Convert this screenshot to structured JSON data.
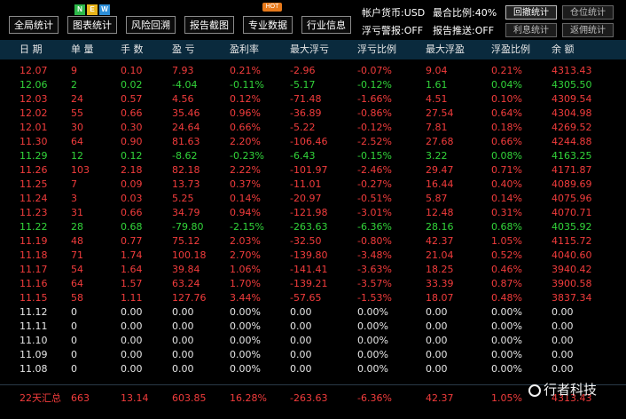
{
  "toolbar": {
    "buttons": [
      "全局统计",
      "图表统计",
      "风险回溯",
      "报告截图",
      "专业数据",
      "行业信息"
    ],
    "badge_n": "N",
    "badge_e": "E",
    "badge_w": "W",
    "hot_badge": "HOT",
    "account_currency": "帐户货币:USD",
    "combo_ratio": "最合比例:40%",
    "float_alert": "浮亏警报:OFF",
    "report_push": "报告推送:OFF",
    "btn_drawdown": "回撤统计",
    "btn_position": "仓位统计",
    "btn_interest": "利息统计",
    "btn_rebate": "返佣统计"
  },
  "table": {
    "headers": [
      "日 期",
      "单 量",
      "手 数",
      "盈 亏",
      "盈利率",
      "最大浮亏",
      "浮亏比例",
      "最大浮盈",
      "浮盈比例",
      "余 额"
    ],
    "rows": [
      {
        "c": "red",
        "v": [
          "12.07",
          "9",
          "0.10",
          "7.93",
          "0.21%",
          "-2.96",
          "-0.07%",
          "9.04",
          "0.21%",
          "4313.43"
        ]
      },
      {
        "c": "green",
        "v": [
          "12.06",
          "2",
          "0.02",
          "-4.04",
          "-0.11%",
          "-5.17",
          "-0.12%",
          "1.61",
          "0.04%",
          "4305.50"
        ]
      },
      {
        "c": "red",
        "v": [
          "12.03",
          "24",
          "0.57",
          "4.56",
          "0.12%",
          "-71.48",
          "-1.66%",
          "4.51",
          "0.10%",
          "4309.54"
        ]
      },
      {
        "c": "red",
        "v": [
          "12.02",
          "55",
          "0.66",
          "35.46",
          "0.96%",
          "-36.89",
          "-0.86%",
          "27.54",
          "0.64%",
          "4304.98"
        ]
      },
      {
        "c": "red",
        "v": [
          "12.01",
          "30",
          "0.30",
          "24.64",
          "0.66%",
          "-5.22",
          "-0.12%",
          "7.81",
          "0.18%",
          "4269.52"
        ]
      },
      {
        "c": "red",
        "v": [
          "11.30",
          "64",
          "0.90",
          "81.63",
          "2.20%",
          "-106.46",
          "-2.52%",
          "27.68",
          "0.66%",
          "4244.88"
        ]
      },
      {
        "c": "green",
        "v": [
          "11.29",
          "12",
          "0.12",
          "-8.62",
          "-0.23%",
          "-6.43",
          "-0.15%",
          "3.22",
          "0.08%",
          "4163.25"
        ]
      },
      {
        "c": "red",
        "v": [
          "11.26",
          "103",
          "2.18",
          "82.18",
          "2.22%",
          "-101.97",
          "-2.46%",
          "29.47",
          "0.71%",
          "4171.87"
        ]
      },
      {
        "c": "red",
        "v": [
          "11.25",
          "7",
          "0.09",
          "13.73",
          "0.37%",
          "-11.01",
          "-0.27%",
          "16.44",
          "0.40%",
          "4089.69"
        ]
      },
      {
        "c": "red",
        "v": [
          "11.24",
          "3",
          "0.03",
          "5.25",
          "0.14%",
          "-20.97",
          "-0.51%",
          "5.87",
          "0.14%",
          "4075.96"
        ]
      },
      {
        "c": "red",
        "v": [
          "11.23",
          "31",
          "0.66",
          "34.79",
          "0.94%",
          "-121.98",
          "-3.01%",
          "12.48",
          "0.31%",
          "4070.71"
        ]
      },
      {
        "c": "green",
        "v": [
          "11.22",
          "28",
          "0.68",
          "-79.80",
          "-2.15%",
          "-263.63",
          "-6.36%",
          "28.16",
          "0.68%",
          "4035.92"
        ]
      },
      {
        "c": "red",
        "v": [
          "11.19",
          "48",
          "0.77",
          "75.12",
          "2.03%",
          "-32.50",
          "-0.80%",
          "42.37",
          "1.05%",
          "4115.72"
        ]
      },
      {
        "c": "red",
        "v": [
          "11.18",
          "71",
          "1.74",
          "100.18",
          "2.70%",
          "-139.80",
          "-3.48%",
          "21.04",
          "0.52%",
          "4040.60"
        ]
      },
      {
        "c": "red",
        "v": [
          "11.17",
          "54",
          "1.64",
          "39.84",
          "1.06%",
          "-141.41",
          "-3.63%",
          "18.25",
          "0.46%",
          "3940.42"
        ]
      },
      {
        "c": "red",
        "v": [
          "11.16",
          "64",
          "1.57",
          "63.24",
          "1.70%",
          "-139.21",
          "-3.57%",
          "33.39",
          "0.87%",
          "3900.58"
        ]
      },
      {
        "c": "red",
        "v": [
          "11.15",
          "58",
          "1.11",
          "127.76",
          "3.44%",
          "-57.65",
          "-1.53%",
          "18.07",
          "0.48%",
          "3837.34"
        ]
      },
      {
        "c": "white",
        "v": [
          "11.12",
          "0",
          "0.00",
          "0.00",
          "0.00%",
          "0.00",
          "0.00%",
          "0.00",
          "0.00%",
          "0.00"
        ]
      },
      {
        "c": "white",
        "v": [
          "11.11",
          "0",
          "0.00",
          "0.00",
          "0.00%",
          "0.00",
          "0.00%",
          "0.00",
          "0.00%",
          "0.00"
        ]
      },
      {
        "c": "white",
        "v": [
          "11.10",
          "0",
          "0.00",
          "0.00",
          "0.00%",
          "0.00",
          "0.00%",
          "0.00",
          "0.00%",
          "0.00"
        ]
      },
      {
        "c": "white",
        "v": [
          "11.09",
          "0",
          "0.00",
          "0.00",
          "0.00%",
          "0.00",
          "0.00%",
          "0.00",
          "0.00%",
          "0.00"
        ]
      },
      {
        "c": "white",
        "v": [
          "11.08",
          "0",
          "0.00",
          "0.00",
          "0.00%",
          "0.00",
          "0.00%",
          "0.00",
          "0.00%",
          "0.00"
        ]
      }
    ],
    "summary": [
      "22天汇总",
      "663",
      "13.14",
      "603.85",
      "16.28%",
      "-263.63",
      "-6.36%",
      "42.37",
      "1.05%",
      "4313.43"
    ]
  },
  "watermark": "行者科技",
  "colors": {
    "profit": "#f23c3c",
    "loss": "#32d43a",
    "neutral": "#e6e6e6",
    "header_bg": "#0a2a3d",
    "badge_n": "#2db84a",
    "badge_e": "#e8b41b",
    "badge_w": "#2d8fd8"
  }
}
